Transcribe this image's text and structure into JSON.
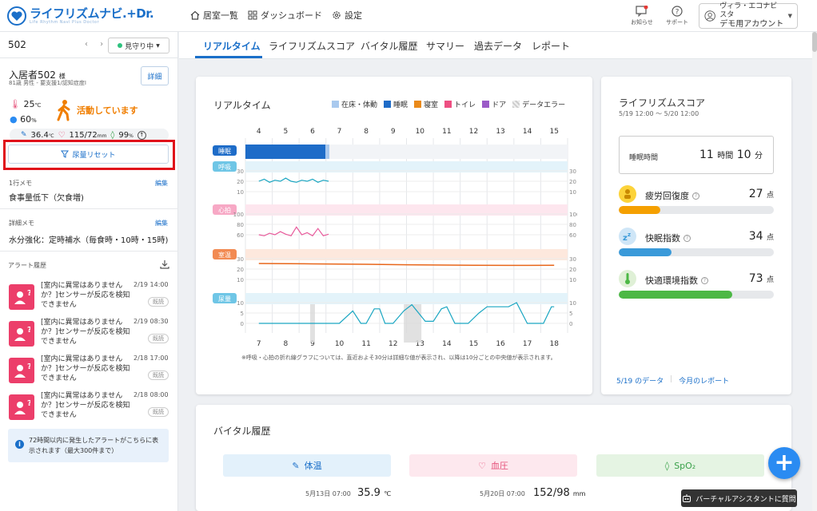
{
  "brand": {
    "logo_text": "ライフリズムナビ.+Dr.",
    "logo_sub": "Life Rhythm Navi Plus Doctor"
  },
  "nav": {
    "rooms": "居室一覧",
    "dashboard": "ダッシュボード",
    "settings": "設定"
  },
  "header_right": {
    "notice": "お知らせ",
    "support": "サポート",
    "account_line1": "ヴィラ・エコナビスタ",
    "account_line2": "デモ用アカウント"
  },
  "sidebar": {
    "room_number": "502",
    "mimamori": "見守り中",
    "resident_name": "入居者502",
    "resident_suffix": "様",
    "resident_sub": "81歳 男性 - 要支援1/認知症度Ⅰ",
    "detail_button": "詳細",
    "temperature": "25",
    "temperature_unit": "℃",
    "humidity": "60",
    "humidity_unit": "%",
    "activity": "活動しています",
    "body_temp": "36.4",
    "body_temp_unit": "℃",
    "bp": "115/72",
    "bp_unit": "mm",
    "spo2": "99",
    "spo2_unit": "%",
    "reset_button": "尿量リセット",
    "memo1_label": "1行メモ",
    "memo1_edit": "編集",
    "memo1_text": "食事量低下（欠食増)",
    "memo2_label": "詳細メモ",
    "memo2_edit": "編集",
    "memo2_text": "水分強化：定時補水（毎食時・10時・15時)",
    "alert_history": "アラート履歴",
    "alerts": [
      {
        "text": "[室内に異常はありませんか？]センサーが反応を検知できません",
        "date": "2/19 14:00",
        "status": "既読"
      },
      {
        "text": "[室内に異常はありませんか？]センサーが反応を検知できません",
        "date": "2/19 08:30",
        "status": "既読"
      },
      {
        "text": "[室内に異常はありませんか？]センサーが反応を検知できません",
        "date": "2/18 17:00",
        "status": "既読"
      },
      {
        "text": "[室内に異常はありませんか？]センサーが反応を検知できません",
        "date": "2/18 08:00",
        "status": "既読"
      }
    ],
    "info_text": "72時間以内に発生したアラートがこちらに表示されます（最大300件まで）"
  },
  "tabs": [
    "リアルタイム",
    "ライフリズムスコア",
    "バイタル履歴",
    "サマリー",
    "過去データ",
    "レポート"
  ],
  "realtime": {
    "title": "リアルタイム",
    "legend": [
      {
        "label": "在床・体動",
        "color": "#a9c9ee"
      },
      {
        "label": "睡眠",
        "color": "#1e6cc8"
      },
      {
        "label": "寝室",
        "color": "#ea8a1a"
      },
      {
        "label": "トイレ",
        "color": "#ee4f82"
      },
      {
        "label": "ドア",
        "color": "#9b5bc8"
      },
      {
        "label": "データエラー",
        "color": "#cccccc"
      }
    ],
    "note": "※呼吸・心拍の折れ線グラフについては、直近およそ30分は詳細な値が表示され、以降は10分ごとの中央値が表示されます。"
  },
  "chart_data": {
    "type": "line",
    "x_top_ticks": [
      "4",
      "5",
      "6",
      "7",
      "8",
      "9",
      "10",
      "11",
      "12",
      "13",
      "14",
      "15"
    ],
    "x_bottom_ticks": [
      "7",
      "8",
      "9",
      "10",
      "11",
      "12",
      "13",
      "14",
      "15",
      "16",
      "17",
      "18"
    ],
    "rows": [
      {
        "label": "睡眠",
        "color": "#1e6cc8"
      },
      {
        "label": "呼吸",
        "color": "#1aa6c2",
        "ticks": [
          "30",
          "20",
          "10"
        ],
        "series": [
          [
            4.0,
            20
          ],
          [
            4.2,
            22
          ],
          [
            4.4,
            19
          ],
          [
            4.6,
            21
          ],
          [
            4.8,
            20
          ],
          [
            5.0,
            23
          ],
          [
            5.2,
            20
          ],
          [
            5.4,
            19
          ],
          [
            5.6,
            21
          ],
          [
            5.8,
            20
          ],
          [
            6.0,
            22
          ],
          [
            6.2,
            19
          ],
          [
            6.4,
            21
          ],
          [
            6.6,
            20
          ]
        ]
      },
      {
        "label": "心拍",
        "color": "#e8589a",
        "ticks": [
          "100",
          "80",
          "60"
        ],
        "series": [
          [
            4.0,
            60
          ],
          [
            4.2,
            58
          ],
          [
            4.4,
            63
          ],
          [
            4.6,
            60
          ],
          [
            4.8,
            66
          ],
          [
            5.0,
            61
          ],
          [
            5.2,
            58
          ],
          [
            5.4,
            75
          ],
          [
            5.6,
            60
          ],
          [
            5.8,
            64
          ],
          [
            6.0,
            58
          ],
          [
            6.2,
            72
          ],
          [
            6.4,
            58
          ],
          [
            6.6,
            61
          ]
        ]
      },
      {
        "label": "室温",
        "color": "#e8661a",
        "ticks": [
          "30",
          "20",
          "10"
        ],
        "series": [
          [
            4.0,
            25.4
          ],
          [
            6.0,
            25.0
          ],
          [
            8.0,
            24.6
          ],
          [
            10.0,
            24.0
          ],
          [
            12.0,
            23.6
          ],
          [
            14.0,
            23.5
          ],
          [
            15.0,
            23.7
          ]
        ]
      },
      {
        "label": "尿量",
        "color": "#1aa6c2",
        "ticks": [
          "10",
          "5",
          "0"
        ],
        "series": [
          [
            7.0,
            0
          ],
          [
            9.0,
            0
          ],
          [
            10.0,
            0
          ],
          [
            10.5,
            6
          ],
          [
            10.8,
            0
          ],
          [
            11.0,
            0
          ],
          [
            11.3,
            7
          ],
          [
            11.5,
            7
          ],
          [
            11.7,
            0
          ],
          [
            12.0,
            0
          ],
          [
            12.4,
            6
          ],
          [
            12.7,
            9
          ],
          [
            13.2,
            1
          ],
          [
            13.5,
            1
          ],
          [
            13.8,
            7
          ],
          [
            14.0,
            8
          ],
          [
            14.3,
            0
          ],
          [
            14.8,
            0
          ],
          [
            15.2,
            5
          ],
          [
            15.5,
            8
          ],
          [
            16.0,
            8
          ],
          [
            16.3,
            8
          ],
          [
            16.6,
            10
          ],
          [
            17.0,
            0
          ],
          [
            17.6,
            0
          ],
          [
            17.9,
            8
          ],
          [
            18.0,
            8
          ]
        ]
      }
    ]
  },
  "score": {
    "title": "ライフリズムスコア",
    "period": "5/19 12:00 ～ 5/20 12:00",
    "sleep_label": "睡眠時間",
    "sleep_hours": "11",
    "sleep_h_unit": "時間",
    "sleep_minutes": "10",
    "sleep_m_unit": "分",
    "items": [
      {
        "name": "疲労回復度",
        "value": "27",
        "unit": "点",
        "percent": 27,
        "color": "#f5a000",
        "icon_bg": "#fcd33a"
      },
      {
        "name": "快眠指数",
        "value": "34",
        "unit": "点",
        "percent": 34,
        "color": "#3a9ad9",
        "icon_bg": "#cfe6f7"
      },
      {
        "name": "快適環境指数",
        "value": "73",
        "unit": "点",
        "percent": 73,
        "color": "#4cb845",
        "icon_bg": "#dff0d6"
      }
    ],
    "link_data": "5/19 のデータ",
    "link_report": "今月のレポート"
  },
  "vital_history": {
    "title": "バイタル履歴",
    "tiles": [
      {
        "label": "体温",
        "bg": "#e3f1fb",
        "color": "#1a6fc9"
      },
      {
        "label": "血圧",
        "bg": "#fde8ee",
        "color": "#e54f78"
      },
      {
        "label": "SpO₂",
        "bg": "#e5f4e3",
        "color": "#3aa14a"
      }
    ],
    "temp_date": "5月13日 07:00",
    "temp_value": "35.9",
    "temp_unit": "℃",
    "bp_date": "5月20日 07:00",
    "bp_value": "152/98",
    "bp_unit": "mm"
  },
  "assistant": {
    "label": "バーチャルアシスタントに質問"
  }
}
